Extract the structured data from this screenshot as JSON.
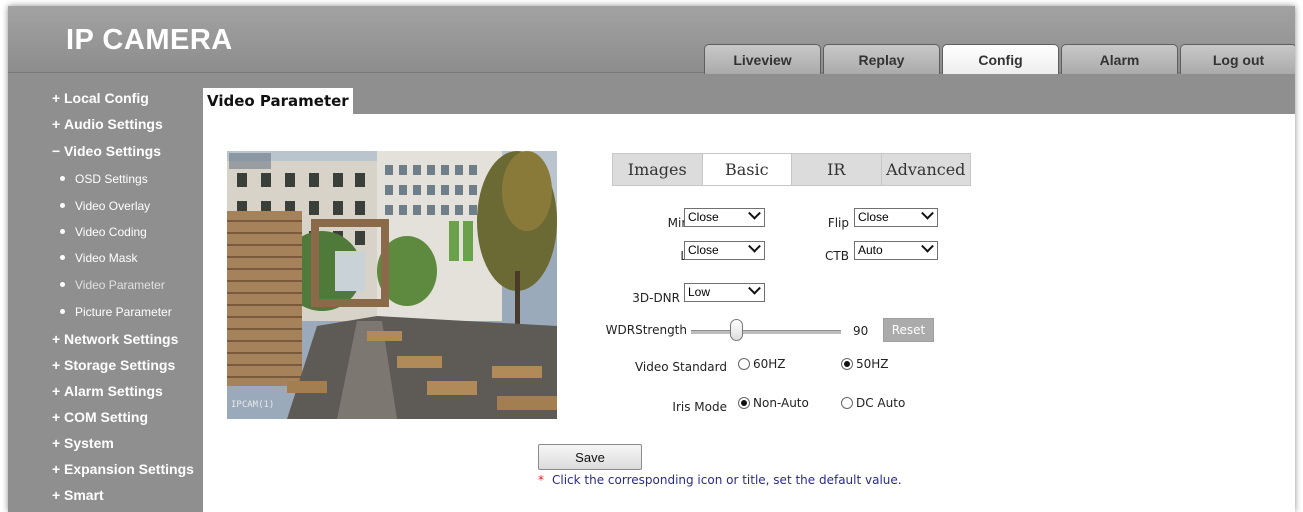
{
  "app": {
    "title": "IP CAMERA"
  },
  "nav": {
    "tabs": [
      {
        "label": "Liveview"
      },
      {
        "label": "Replay"
      },
      {
        "label": "Config"
      },
      {
        "label": "Alarm"
      },
      {
        "label": "Log out"
      }
    ],
    "active": "Config"
  },
  "sidebar": {
    "menus": [
      {
        "sign": "+",
        "label": "Local Config"
      },
      {
        "sign": "+",
        "label": "Audio Settings"
      },
      {
        "sign": "−",
        "label": "Video Settings"
      },
      {
        "sign": "+",
        "label": "Network Settings"
      },
      {
        "sign": "+",
        "label": "Storage Settings"
      },
      {
        "sign": "+",
        "label": "Alarm Settings"
      },
      {
        "sign": "+",
        "label": "COM Setting"
      },
      {
        "sign": "+",
        "label": "System"
      },
      {
        "sign": "+",
        "label": "Expansion Settings"
      },
      {
        "sign": "+",
        "label": "Smart"
      }
    ],
    "video_subitems": [
      {
        "label": "OSD Settings"
      },
      {
        "label": "Video Overlay"
      },
      {
        "label": "Video Coding"
      },
      {
        "label": "Video Mask"
      },
      {
        "label": "Video Parameter"
      },
      {
        "label": "Picture Parameter"
      }
    ],
    "active_subitem": "Video Parameter"
  },
  "page": {
    "title": "Video Parameter"
  },
  "preview": {
    "osd_label": "IPCAM(1)"
  },
  "subtabs": [
    {
      "label": "Images"
    },
    {
      "label": "Basic"
    },
    {
      "label": "IR"
    },
    {
      "label": "Advanced"
    }
  ],
  "active_subtab": "Basic",
  "form": {
    "mirror": {
      "label": "Mirror",
      "value": "Close"
    },
    "flip": {
      "label": "Flip",
      "value": "Close"
    },
    "lsc": {
      "label": "LSC",
      "value": "Close"
    },
    "ctb": {
      "label": "CTB",
      "value": "Auto"
    },
    "dnr": {
      "label": "3D-DNR",
      "value": "Low"
    },
    "wdr": {
      "label": "WDRStrength",
      "value": "90",
      "level": 90,
      "reset_label": "Reset"
    },
    "video_standard": {
      "label": "Video Standard",
      "options": [
        "60HZ",
        "50HZ"
      ],
      "selected": "50HZ"
    },
    "iris_mode": {
      "label": "Iris Mode",
      "options": [
        "Non-Auto",
        "DC Auto"
      ],
      "selected": "Non-Auto"
    }
  },
  "actions": {
    "save_label": "Save"
  },
  "hint": {
    "star": "*",
    "text": "Click the corresponding icon or title, set the default value."
  }
}
